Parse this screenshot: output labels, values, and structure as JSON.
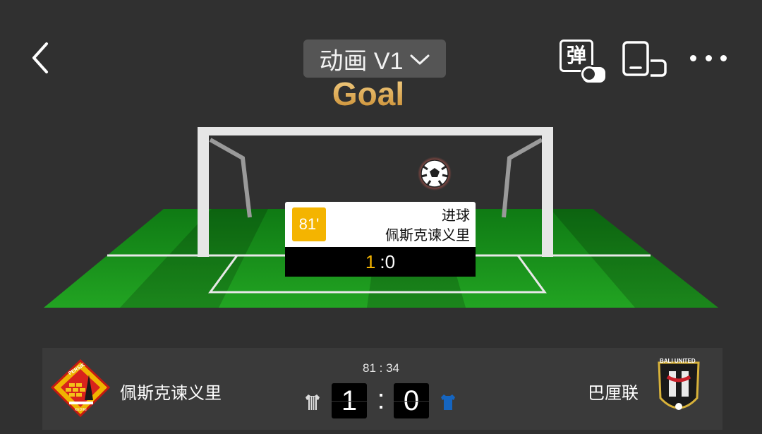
{
  "header": {
    "mode_label": "动画 V1",
    "danmu_label": "弹"
  },
  "animation": {
    "title": "Goal",
    "event": {
      "minute": "81'",
      "type": "进球",
      "team": "佩斯克谏义里",
      "score_home": "1",
      "score_sep": ":",
      "score_away": "0"
    }
  },
  "scorebar": {
    "home_team": "佩斯克谏义里",
    "away_team": "巴厘联",
    "clock": "81 : 34",
    "home_score": "1",
    "colon": ":",
    "away_score": "0",
    "home_logo_text": "PERSIK",
    "home_logo_subtext": "KEDIRI",
    "away_logo_text": "BALI UNITED"
  },
  "colors": {
    "background": "#303030",
    "pitch_green": "#1f9a1f",
    "accent_gold": "#f4b400",
    "away_kit": "#1565c0"
  }
}
